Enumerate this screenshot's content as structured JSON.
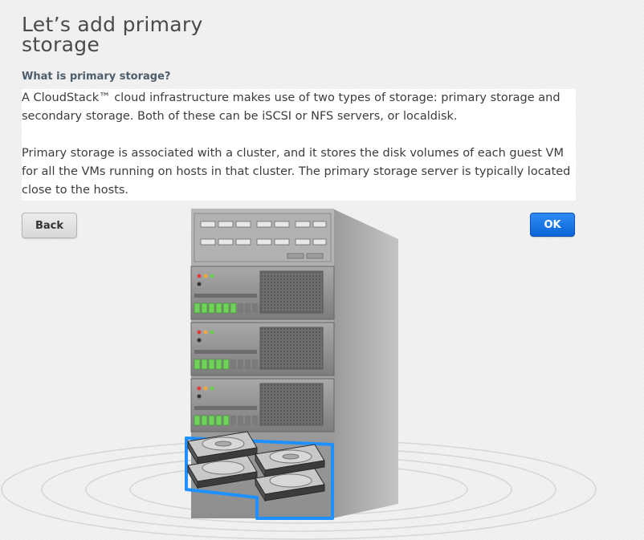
{
  "page": {
    "title": "Let’s add primary storage",
    "subtitle": "What is primary storage?",
    "paragraph1": "A CloudStack™ cloud infrastructure makes use of two types of storage: primary storage and secondary storage. Both of these can be iSCSI or NFS servers, or localdisk.",
    "paragraph2": "Primary storage is associated with a cluster, and it stores the disk volumes of each guest VM for all the VMs running on hosts in that cluster. The primary storage server is typically located close to the hosts."
  },
  "buttons": {
    "back_label": "Back",
    "ok_label": "OK"
  },
  "colors": {
    "accent_blue": "#0a64d8",
    "highlight_blue": "#1e90ff"
  },
  "illustration": {
    "icon": "storage-server-rack-icon"
  }
}
